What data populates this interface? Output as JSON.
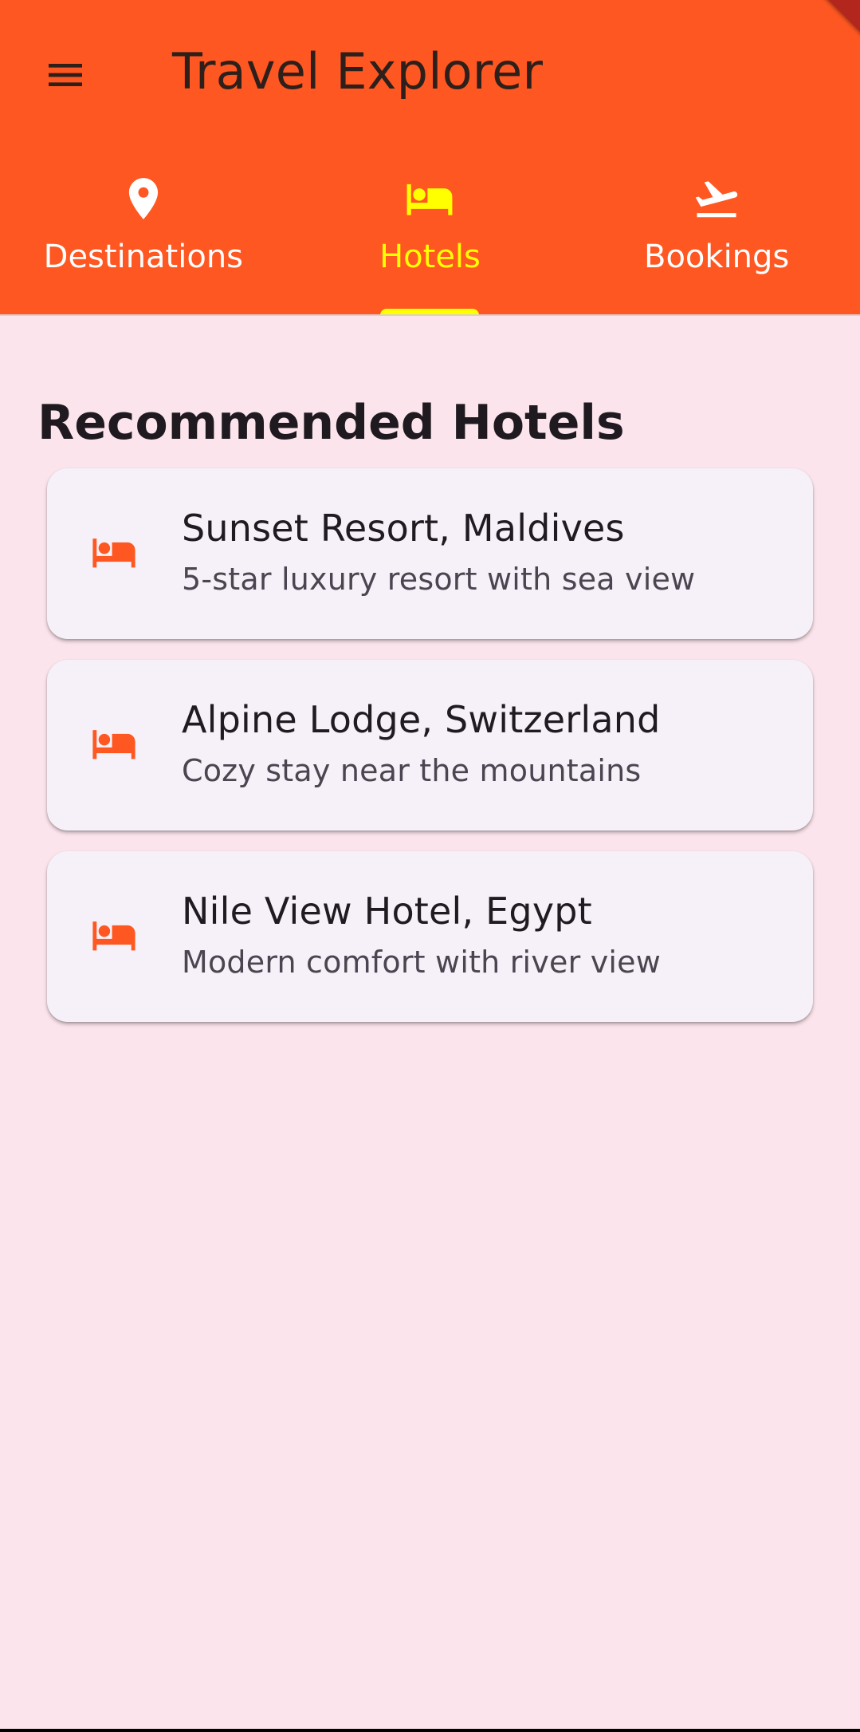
{
  "app": {
    "title": "Travel Explorer"
  },
  "tabs": [
    {
      "label": "Destinations",
      "icon": "location-pin-icon",
      "active": false
    },
    {
      "label": "Hotels",
      "icon": "hotel-bed-icon",
      "active": true
    },
    {
      "label": "Bookings",
      "icon": "flight-takeoff-icon",
      "active": false
    }
  ],
  "main": {
    "section_title": "Recommended Hotels",
    "hotels": [
      {
        "name": "Sunset Resort, Maldives",
        "description": "5-star luxury resort with sea view",
        "icon": "hotel-bed-icon"
      },
      {
        "name": "Alpine Lodge, Switzerland",
        "description": "Cozy stay near the mountains",
        "icon": "hotel-bed-icon"
      },
      {
        "name": "Nile View Hotel, Egypt",
        "description": "Modern comfort with river view",
        "icon": "hotel-bed-icon"
      }
    ]
  },
  "colors": {
    "app_bar": "#ff5722",
    "active_tab": "#ffff00",
    "background": "#fce4ec",
    "card": "#f6f1f8",
    "hotel_icon": "#ff5722"
  }
}
